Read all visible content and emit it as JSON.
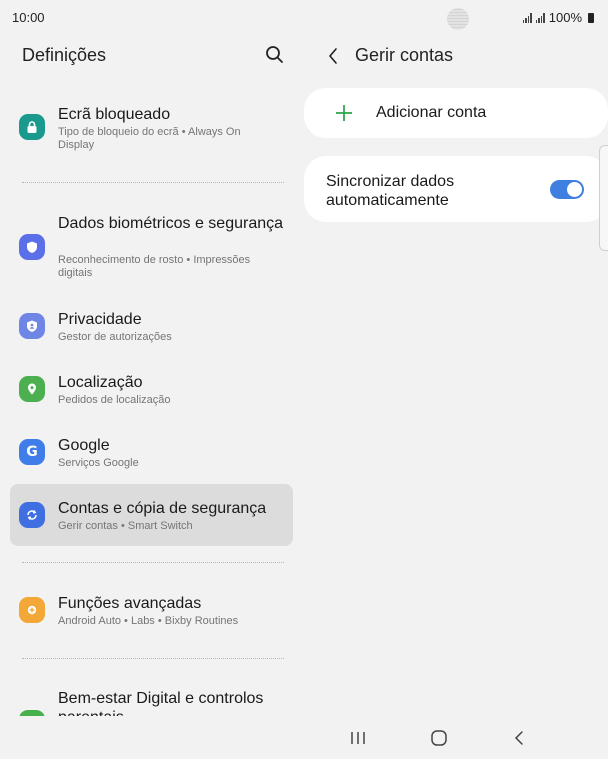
{
  "status_bar": {
    "time": "10:00",
    "battery": "100%"
  },
  "left_pane": {
    "title": "Definições",
    "items": [
      {
        "title": "Ecrã bloqueado",
        "subtitle": "Tipo de bloqueio do ecrã • Always On Display",
        "icon": "lock-icon",
        "color": "#1a9a8c"
      },
      {
        "title": "Dados biométricos e segurança",
        "subtitle": "Reconhecimento de rosto • Impressões digitais",
        "icon": "shield-icon",
        "color": "#5b6fe8"
      },
      {
        "title": "Privacidade",
        "subtitle": "Gestor de autorizações",
        "icon": "privacy-shield-icon",
        "color": "#6f86e6"
      },
      {
        "title": "Localização",
        "subtitle": "Pedidos de localização",
        "icon": "location-pin-icon",
        "color": "#4caf50"
      },
      {
        "title": "Google",
        "subtitle": "Serviços Google",
        "icon": "google-icon",
        "color": "#3f7ee8"
      },
      {
        "title": "Contas e cópia de segurança",
        "subtitle": "Gerir contas • Smart Switch",
        "icon": "sync-icon",
        "color": "#3f6fe0"
      },
      {
        "title": "Funções avançadas",
        "subtitle": "Android Auto • Labs • Bixby Routines",
        "icon": "gear-plus-icon",
        "color": "#f2a736"
      },
      {
        "title": "Bem-estar Digital e controlos parentais",
        "subtitle": "",
        "icon": "wellbeing-icon",
        "color": "#47b04b"
      }
    ]
  },
  "right_pane": {
    "title": "Gerir contas",
    "add_account": "Adicionar conta",
    "sync_label": "Sincronizar dados automaticamente",
    "sync_on": true
  },
  "colors": {
    "accent": "#3e7fe0",
    "add_plus": "#2fa84f",
    "selected_bg": "#dcdcdc"
  }
}
